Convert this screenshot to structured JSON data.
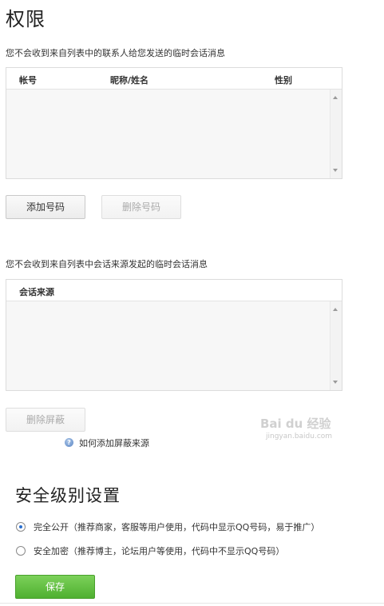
{
  "header": {
    "title": "权限"
  },
  "contacts_section": {
    "description": "您不会收到来自列表中的联系人给您发送的临时会话消息",
    "columns": [
      "帐号",
      "昵称/姓名",
      "性别"
    ],
    "add_button": "添加号码",
    "remove_button": "删除号码"
  },
  "sources_section": {
    "description": "您不会收到来自列表中会话来源发起的临时会话消息",
    "columns": [
      "会话来源"
    ],
    "remove_button": "删除屏蔽",
    "help_icon_glyph": "?",
    "help_link": "如何添加屏蔽来源"
  },
  "security": {
    "title": "安全级别设置",
    "options": [
      {
        "label": "完全公开（推荐商家，客服等用户使用，代码中显示QQ号码，易于推广）",
        "checked": true
      },
      {
        "label": "安全加密（推荐博主，论坛用户等使用，代码中不显示QQ号码）",
        "checked": false
      }
    ],
    "save_button": "保存"
  },
  "watermark": {
    "line1": "Bai du 经验",
    "line2": "jingyan.baidu.com"
  },
  "colors": {
    "accent_green": "#5cbd3a",
    "radio_blue": "#2a6fcf"
  },
  "icons": {
    "help": "help-icon",
    "scroll_up": "arrow-up-icon",
    "scroll_down": "arrow-down-icon"
  }
}
